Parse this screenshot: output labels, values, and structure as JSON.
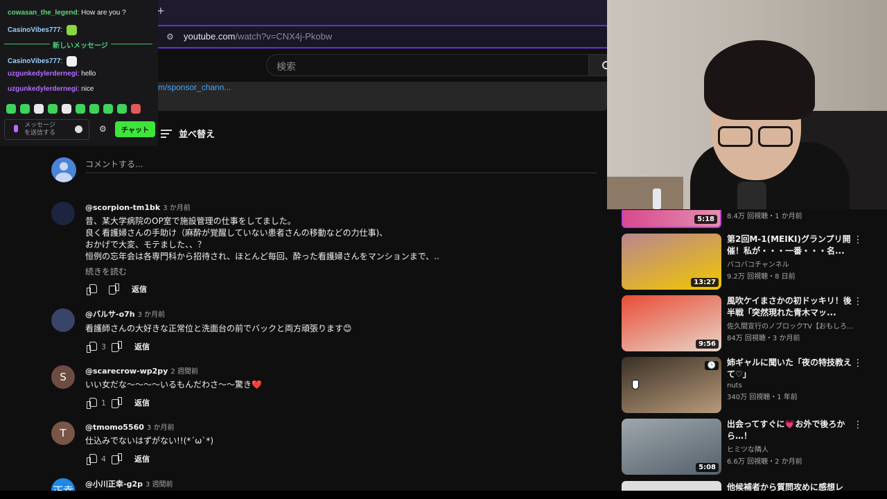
{
  "browser": {
    "new_tab": "+",
    "url_host": "youtube.com",
    "url_path": "/watch?v=CNX4j-Pkobw"
  },
  "youtube": {
    "search_placeholder": "検索",
    "sponsor_link": "m/sponsor_chann...",
    "sort_label": "並べ替え",
    "comment_placeholder": "コメントする..."
  },
  "comments": [
    {
      "author": "@scorpion-tm1bk",
      "time": "3 か月前",
      "lines": [
        "昔、某大学病院のOP室で施設管理の仕事をしてました。",
        "良く看護婦さんの手助け（麻酔が覚醒していない患者さんの移動などの力仕事)、",
        "おかげで大変、モテました、、？",
        "恒例の忘年会は各専門科から招待され、ほとんど毎回、酔った看護婦さんをマンションまで、.."
      ],
      "more": "続きを読む",
      "likes": "",
      "reply": "返信",
      "avatar_color": "#1c2440",
      "avatar_text": ""
    },
    {
      "author": "@バルサ-o7h",
      "time": "3 か月前",
      "lines": [
        "看護師さんの大好きな正常位と洗面台の前でバックと両方頑張ります😊"
      ],
      "likes": "3",
      "reply": "返信",
      "avatar_color": "#3a4468",
      "avatar_text": ""
    },
    {
      "author": "@scarecrow-wp2py",
      "time": "2 週間前",
      "lines": [
        "いい女だな〜〜〜〜いるもんだわさ〜〜驚き❤️"
      ],
      "likes": "1",
      "reply": "返信",
      "avatar_color": "#6d4c41",
      "avatar_text": "S"
    },
    {
      "author": "@tmomo5560",
      "time": "3 か月前",
      "lines": [
        "仕込みでないはずがない!!(*´ω`*)"
      ],
      "likes": "4",
      "reply": "返信",
      "avatar_color": "#795548",
      "avatar_text": "T"
    },
    {
      "author": "@小川正幸-g2p",
      "time": "3 週間前",
      "lines": [],
      "likes": "",
      "reply": "",
      "avatar_color": "#1e88e5",
      "avatar_text": "正幸"
    }
  ],
  "chat": {
    "messages": [
      {
        "user": "cowasan_the_legend",
        "text": "How are you ?",
        "user_color": "#5cd67a"
      },
      {
        "user": "CasinoVibes777",
        "text": "",
        "user_color": "#9ad0ff",
        "emote_color": "#8cd63f"
      },
      {
        "user": "CasinoVibes777",
        "text": "",
        "user_color": "#9ad0ff",
        "emote_color": "#f0f0f0"
      },
      {
        "user": "uzgunkedylerdernegi",
        "text": "hello",
        "user_color": "#b36bff"
      },
      {
        "user": "uzgunkedylerdernegi",
        "text": "nice",
        "user_color": "#b36bff"
      }
    ],
    "new_messages_label": "新しいメッセージ",
    "input_placeholder_1": "メッセージ",
    "input_placeholder_2": "を送信する",
    "send_label": "チャット",
    "settings_icon": "gear-icon"
  },
  "suggested": {
    "top_meta": "8.4万 回視聴・1 か月前",
    "top_duration": "5:18",
    "videos": [
      {
        "title": "第2回M-1(MEIKI)グランプリ開催！私が・・・一番・・・名...",
        "channel": "バコバコチャンネル",
        "meta": "9.2万 回視聴・8 日前",
        "duration": "13:27",
        "thumb_a": "#b8868e",
        "thumb_b": "#f2c700"
      },
      {
        "title": "風吹ケイまさかの初ドッキリ！後半戦「突然現れた青木マッ...",
        "channel": "佐久間宣行のノブロックTV【おもしろ...",
        "meta": "84万 回視聴・3 か月前",
        "duration": "9:56",
        "thumb_a": "#e94c36",
        "thumb_b": "#e8d5c8"
      },
      {
        "title": "姉ギャルに聞いた「夜の特技教えて♡」",
        "channel": "nuts",
        "meta": "340万 回視聴・1 年前",
        "duration": "",
        "thumb_a": "#3a3026",
        "thumb_b": "#b89a7a"
      },
      {
        "title": "出会ってすぐに💗お外で後ろから…！",
        "channel": "ヒミツな隣人",
        "meta": "6.6万 回視聴・2 か月前",
        "duration": "5:08",
        "thumb_a": "#9ea7ad",
        "thumb_b": "#55606a"
      }
    ],
    "partial_title": "他候補者から質問攻めに感想レ"
  }
}
